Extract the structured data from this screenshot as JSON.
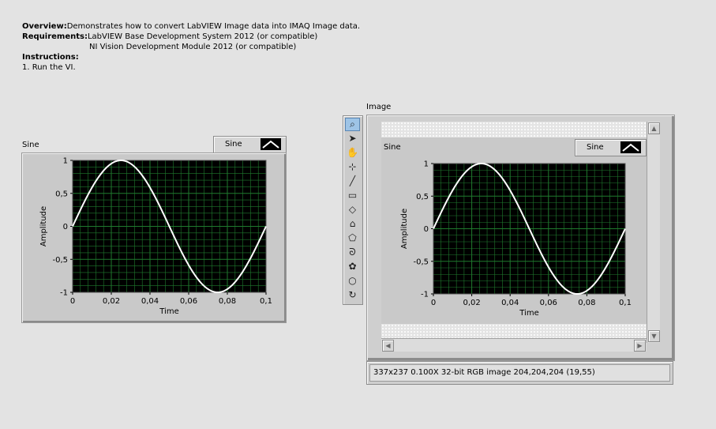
{
  "description": {
    "overview_label": "Overview:",
    "overview_text": "Demonstrates how to convert LabVIEW Image data into IMAQ Image data.",
    "requirements_label": "Requirements:",
    "requirements_line1": "LabVIEW Base Development System 2012 (or compatible)",
    "requirements_line2": "NI Vision Development Module 2012 (or compatible)",
    "instructions_label": "Instructions:",
    "instructions_step1": "1. Run the VI."
  },
  "graph": {
    "label": "Sine",
    "legend_name": "Sine"
  },
  "image_display": {
    "label": "Image",
    "status_text": "337x237 0.100X 32-bit RGB image 204,204,204    (19,55)",
    "embedded_graph_label": "Sine",
    "embedded_legend_name": "Sine"
  },
  "tools": [
    {
      "name": "zoom-tool-icon",
      "glyph": "⌕"
    },
    {
      "name": "selection-tool-icon",
      "glyph": "➤"
    },
    {
      "name": "pan-tool-icon",
      "glyph": "✋"
    },
    {
      "name": "point-tool-icon",
      "glyph": "⊹"
    },
    {
      "name": "line-tool-icon",
      "glyph": "╱"
    },
    {
      "name": "rectangle-tool-icon",
      "glyph": "▭"
    },
    {
      "name": "rotated-rectangle-tool-icon",
      "glyph": "◇"
    },
    {
      "name": "annulus-tool-icon",
      "glyph": "⌂"
    },
    {
      "name": "polygon-tool-icon",
      "glyph": "⬠"
    },
    {
      "name": "freehand-tool-icon",
      "glyph": "ᘐ"
    },
    {
      "name": "freehand-region-tool-icon",
      "glyph": "✿"
    },
    {
      "name": "oval-tool-icon",
      "glyph": "○"
    },
    {
      "name": "broken-line-tool-icon",
      "glyph": "↻"
    }
  ],
  "colors": {
    "plot_bg": "#000000",
    "grid": "#1f7a2e",
    "trace": "#ffffff",
    "frame": "#c9c9c9",
    "page_bg": "#e3e3e3"
  },
  "chart_data": [
    {
      "type": "line",
      "title": "Sine",
      "xlabel": "Time",
      "ylabel": "Amplitude",
      "xlim": [
        0,
        0.1
      ],
      "ylim": [
        -1,
        1
      ],
      "x_ticks": [
        "0",
        "0,02",
        "0,04",
        "0,06",
        "0,08",
        "0,1"
      ],
      "y_ticks": [
        "1",
        "0,5",
        "0",
        "-0,5",
        "-1"
      ],
      "grid": true,
      "series": [
        {
          "name": "Sine",
          "function": "sin(2*pi*10*t)",
          "t_range": [
            0,
            0.1
          ],
          "x": [
            0,
            0.025,
            0.05,
            0.075,
            0.1
          ],
          "y": [
            0,
            1,
            0,
            -1,
            0
          ]
        }
      ]
    },
    {
      "type": "line",
      "title": "Sine",
      "xlabel": "Time",
      "ylabel": "Amplitude",
      "xlim": [
        0,
        0.1
      ],
      "ylim": [
        -1,
        1
      ],
      "x_ticks": [
        "0",
        "0,02",
        "0,04",
        "0,06",
        "0,08",
        "0,1"
      ],
      "y_ticks": [
        "1",
        "0,5",
        "0",
        "-0,5",
        "-1"
      ],
      "grid": true,
      "series": [
        {
          "name": "Sine",
          "function": "sin(2*pi*10*t)",
          "t_range": [
            0,
            0.1
          ],
          "x": [
            0,
            0.025,
            0.05,
            0.075,
            0.1
          ],
          "y": [
            0,
            1,
            0,
            -1,
            0
          ]
        }
      ]
    }
  ]
}
